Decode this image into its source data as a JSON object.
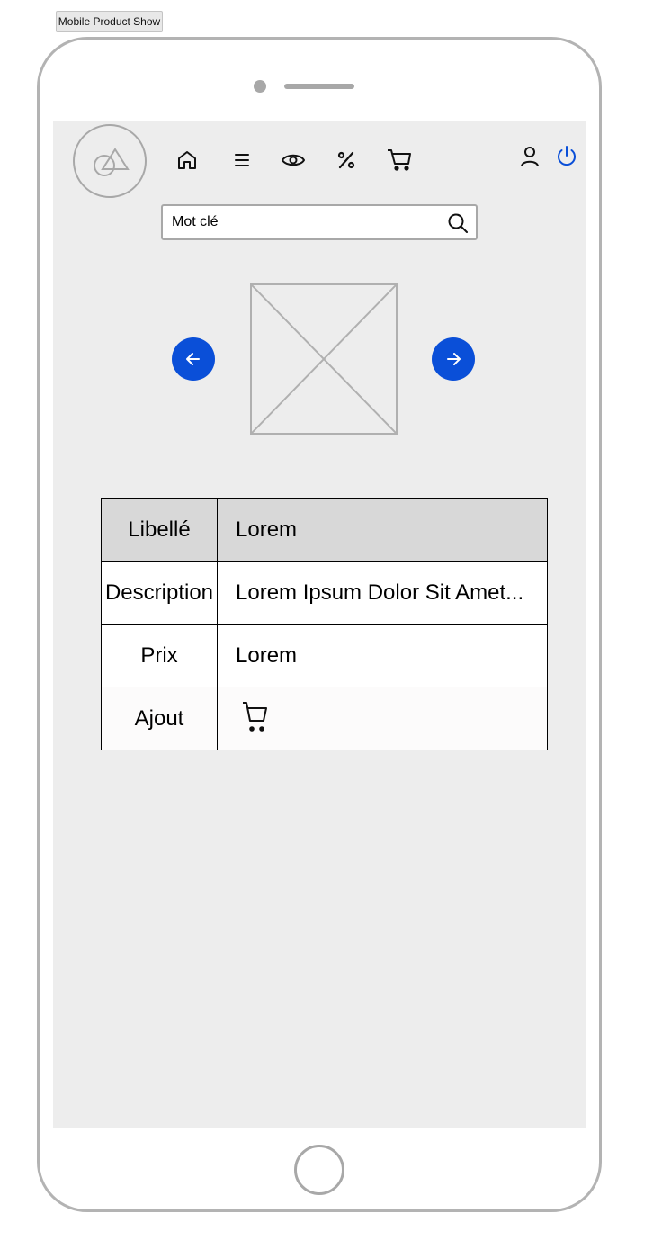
{
  "frame": {
    "title": "Mobile Product Show"
  },
  "nav": {
    "icons": [
      "home-icon",
      "menu-icon",
      "eye-icon",
      "percent-icon",
      "cart-icon",
      "user-icon",
      "power-icon"
    ],
    "power_color": "#0a4fd8"
  },
  "search": {
    "value": "Mot clé",
    "icon": "search-icon"
  },
  "carousel": {
    "prev_icon": "arrow-left-icon",
    "next_icon": "arrow-right-icon",
    "button_color": "#0a4fd8"
  },
  "product": {
    "header": {
      "label": "Libellé",
      "value": "Lorem"
    },
    "rows": [
      {
        "label": "Description",
        "value": "Lorem Ipsum Dolor Sit Amet..."
      },
      {
        "label": "Prix",
        "value": "Lorem"
      }
    ],
    "add": {
      "label": "Ajout",
      "icon": "cart-icon"
    }
  },
  "colors": {
    "screen_bg": "#ededed",
    "accent": "#0a4fd8",
    "table_header_bg": "#d8d8d8"
  }
}
